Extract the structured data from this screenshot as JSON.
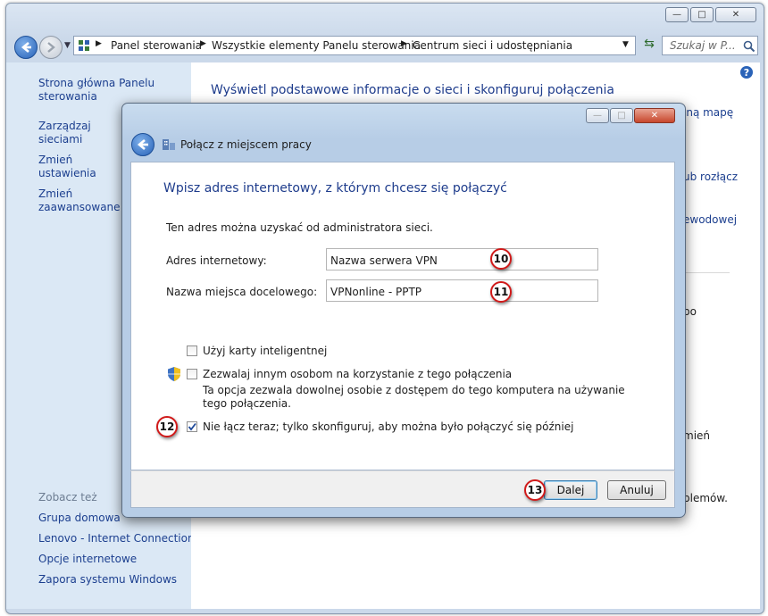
{
  "window": {
    "caption_buttons": {
      "minimize": "▭",
      "maximize": "□",
      "close": "✕"
    }
  },
  "navbar": {
    "breadcrumbs": [
      "Panel sterowania",
      "Wszystkie elementy Panelu sterowania",
      "Centrum sieci i udostępniania"
    ],
    "search_placeholder": "Szukaj w P..."
  },
  "sidebar": {
    "items": [
      {
        "label": "Strona główna Panelu sterowania"
      },
      {
        "label": "Zarządzaj sieciami bezprzewodowymi"
      },
      {
        "label": "Zmień ustawienia karty sieciowej"
      },
      {
        "label": "Zmień zaawansowane ustawienia udostępniania"
      }
    ],
    "see_also_heading": "Zobacz też",
    "see_also": [
      "Grupa domowa",
      "Lenovo - Internet Connection",
      "Opcje internetowe",
      "Zapora systemu Windows"
    ]
  },
  "main": {
    "heading": "Wyświetl podstawowe informacje o sieci i skonfiguruj połączenia",
    "partial_texts": [
      "lną mapę",
      "ub rozłącz",
      "ewodowej",
      "bo",
      "mień",
      "blemów."
    ]
  },
  "dialog": {
    "title": "Połącz z miejscem pracy",
    "heading": "Wpisz adres internetowy, z którym chcesz się połączyć",
    "info": "Ten adres można uzyskać od administratora sieci.",
    "address_label": "Adres internetowy:",
    "address_value": "Nazwa serwera VPN",
    "destination_label": "Nazwa miejsca docelowego:",
    "destination_value": "VPNonline - PPTP",
    "checkboxes": [
      {
        "label": "Użyj karty inteligentnej",
        "checked": false
      },
      {
        "label": "Zezwalaj innym osobom na korzystanie z tego połączenia",
        "checked": false
      },
      {
        "label": "Nie łącz teraz; tylko skonfiguruj, aby można było połączyć się później",
        "checked": true
      }
    ],
    "allow_others_note": "Ta opcja zezwala dowolnej osobie z dostępem do tego komputera na używanie tego połączenia.",
    "next_button": "Dalej",
    "cancel_button": "Anuluj"
  },
  "annotations": [
    "10",
    "11",
    "12",
    "13"
  ]
}
